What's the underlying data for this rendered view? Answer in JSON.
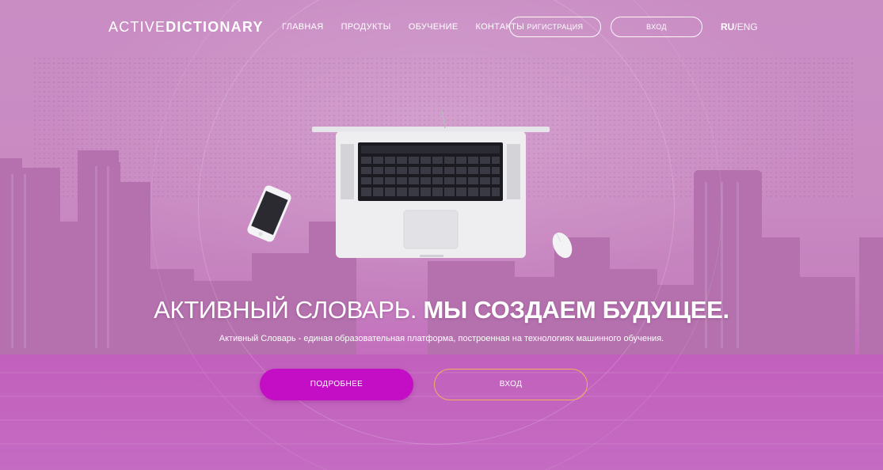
{
  "header": {
    "logo_light": "ACTIVE",
    "logo_bold": "DICTIONARY",
    "nav": [
      "ГЛАВНАЯ",
      "ПРОДУКТЫ",
      "ОБУЧЕНИЕ",
      "КОНТАКТЫ"
    ],
    "register_label": "РИГИСТРАЦИЯ",
    "login_label": "ВХОД",
    "lang_ru": "RU",
    "lang_sep": "/",
    "lang_en": "ENG"
  },
  "hero": {
    "title_light": "АКТИВНЫЙ СЛОВАРЬ.",
    "title_bold": "МЫ СОЗДАЕМ БУДУЩЕЕ.",
    "subtitle": "Активный Словарь - единая образовательная платформа, построенная на технологиях машинного обучения.",
    "primary_button": "ПОДРОБНЕЕ",
    "secondary_button": "ВХОД"
  },
  "colors": {
    "overlay": "#c98dc4",
    "primary_button": "#c30ec6",
    "secondary_border": "#f0b25a"
  },
  "icons": [
    "laptop-icon",
    "smartphone-icon",
    "mouse-icon"
  ]
}
